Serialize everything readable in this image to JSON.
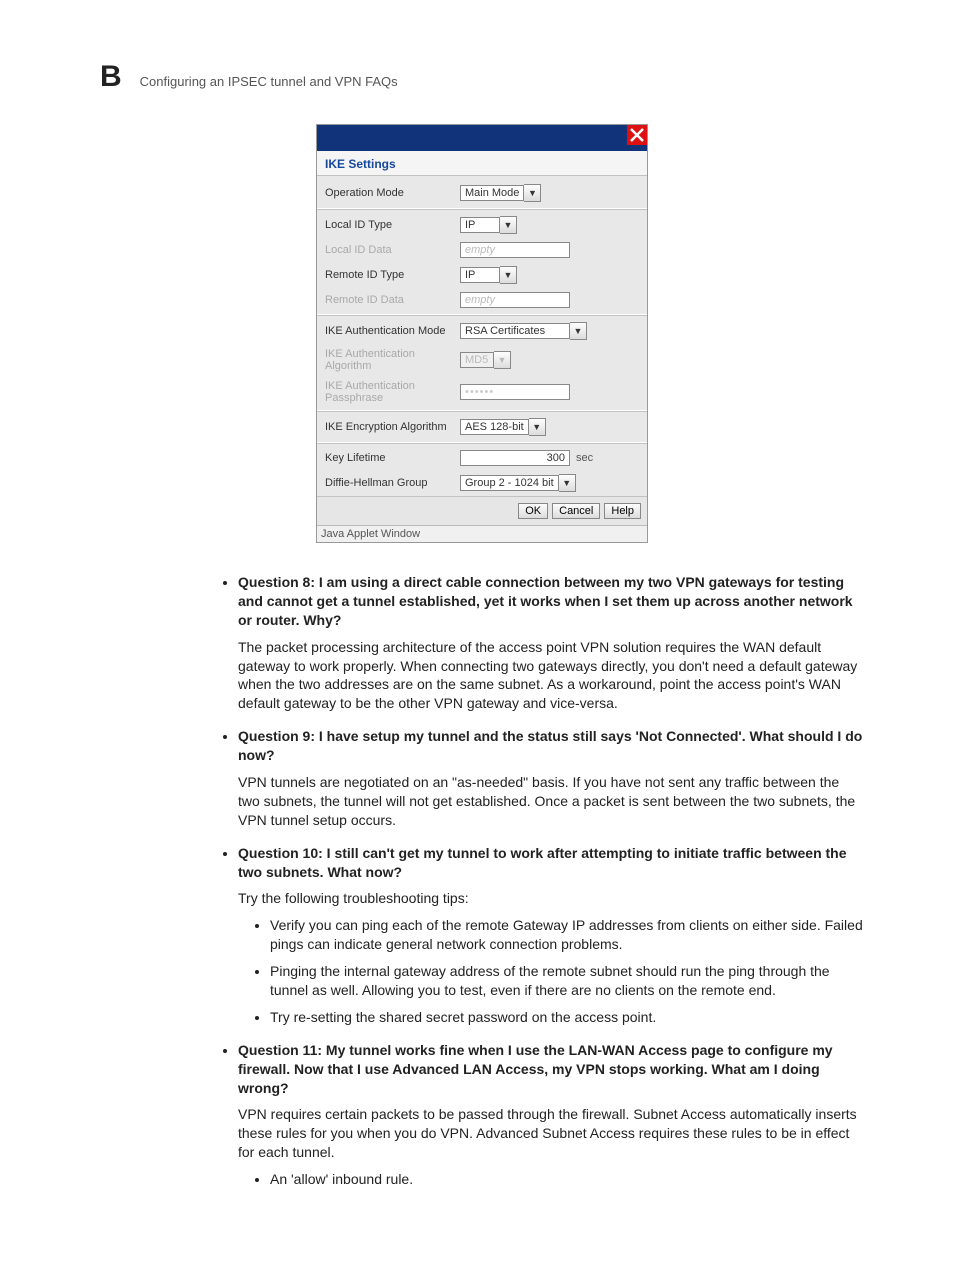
{
  "header": {
    "prefix": "B",
    "title": "Configuring an IPSEC tunnel and VPN FAQs"
  },
  "dialog": {
    "title": "IKE Settings",
    "rows": {
      "operation_mode": {
        "label": "Operation Mode",
        "value": "Main Mode"
      },
      "local_id_type": {
        "label": "Local ID Type",
        "value": "IP"
      },
      "local_id_data": {
        "label": "Local ID Data",
        "placeholder": "empty"
      },
      "remote_id_type": {
        "label": "Remote ID Type",
        "value": "IP"
      },
      "remote_id_data": {
        "label": "Remote ID Data",
        "placeholder": "empty"
      },
      "ike_auth_mode": {
        "label": "IKE Authentication Mode",
        "value": "RSA Certificates"
      },
      "ike_auth_algo": {
        "label": "IKE Authentication Algorithm",
        "value": "MD5"
      },
      "ike_auth_pass": {
        "label": "IKE Authentication Passphrase",
        "placeholder": "••••••"
      },
      "ike_enc_algo": {
        "label": "IKE Encryption Algorithm",
        "value": "AES 128-bit"
      },
      "key_lifetime": {
        "label": "Key Lifetime",
        "value": "300",
        "unit": "sec"
      },
      "dh_group": {
        "label": "Diffie-Hellman Group",
        "value": "Group 2 - 1024 bit"
      }
    },
    "buttons": {
      "ok": "OK",
      "cancel": "Cancel",
      "help": "Help"
    },
    "status": "Java Applet Window"
  },
  "faq": {
    "q8": {
      "q": "Question 8: I am using a direct cable connection between my two VPN gateways for testing and cannot get a tunnel established, yet it works when I set them up across another network or router. Why?",
      "a": "The packet processing architecture of the access point VPN solution requires the WAN default gateway to work properly. When connecting two gateways directly, you don't need a default gateway when the two addresses are on the same subnet. As a workaround, point the access point's WAN default gateway to be the other VPN gateway and vice-versa."
    },
    "q9": {
      "q": "Question 9: I have setup my tunnel and the status still says 'Not Connected'. What should I do now?",
      "a": "VPN tunnels are negotiated on an \"as-needed\" basis. If you have not sent any traffic between the two subnets, the tunnel will not get established. Once a packet is sent between the two subnets, the VPN tunnel setup occurs."
    },
    "q10": {
      "q": "Question 10: I still can't get my tunnel to work after attempting to initiate traffic between the two subnets. What now?",
      "a": "Try the following troubleshooting tips:",
      "tips": [
        "Verify you can ping each of the remote Gateway IP addresses from clients on either side. Failed pings can indicate general network connection problems.",
        "Pinging the internal gateway address of the remote subnet should run the ping through the tunnel as well. Allowing you to test, even if there are no clients on the remote end.",
        "Try re-setting the shared secret password on the access point."
      ]
    },
    "q11": {
      "q": "Question 11: My tunnel works fine when I use the LAN-WAN Access page to configure my firewall. Now that I use Advanced LAN Access, my VPN stops working. What am I doing wrong?",
      "a": "VPN requires certain packets to be passed through the firewall. Subnet Access automatically inserts these rules for you when you do VPN. Advanced Subnet Access requires these rules to be in effect for each tunnel.",
      "tips": [
        "An 'allow' inbound rule."
      ]
    }
  }
}
